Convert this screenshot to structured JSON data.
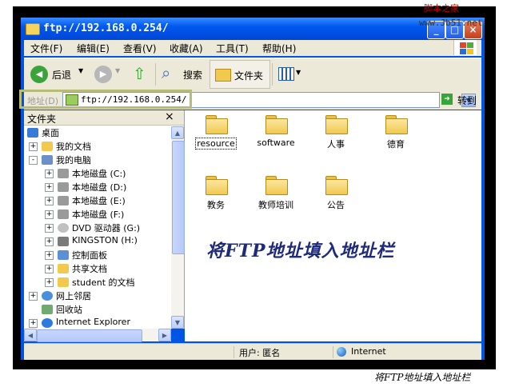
{
  "window": {
    "title": "ftp://192.168.0.254/",
    "watermark": "脚本之家",
    "watermark_url": "www.Jb51.net"
  },
  "menu": [
    "文件(F)",
    "编辑(E)",
    "查看(V)",
    "收藏(A)",
    "工具(T)",
    "帮助(H)"
  ],
  "toolbar": {
    "back_label": "后退",
    "search_label": "搜索",
    "folders_label": "文件夹"
  },
  "address": {
    "label": "地址(D)",
    "value": "ftp://192.168.0.254/",
    "go_label": "转到"
  },
  "folder_pane": {
    "title": "文件夹",
    "close": "×",
    "tree": [
      {
        "label": "桌面",
        "level": 0,
        "expander": "",
        "icon": "desktop-icon"
      },
      {
        "label": "我的文档",
        "level": 1,
        "expander": "+",
        "icon": "documents-icon"
      },
      {
        "label": "我的电脑",
        "level": 1,
        "expander": "-",
        "icon": "computer-icon"
      },
      {
        "label": "本地磁盘 (C:)",
        "level": 2,
        "expander": "+",
        "icon": "drive-icon"
      },
      {
        "label": "本地磁盘 (D:)",
        "level": 2,
        "expander": "+",
        "icon": "drive-icon"
      },
      {
        "label": "本地磁盘 (E:)",
        "level": 2,
        "expander": "+",
        "icon": "drive-icon"
      },
      {
        "label": "本地磁盘 (F:)",
        "level": 2,
        "expander": "+",
        "icon": "drive-icon"
      },
      {
        "label": "DVD 驱动器 (G:)",
        "level": 2,
        "expander": "+",
        "icon": "dvd-icon"
      },
      {
        "label": "KINGSTON (H:)",
        "level": 2,
        "expander": "+",
        "icon": "usb-drive-icon"
      },
      {
        "label": "控制面板",
        "level": 2,
        "expander": "+",
        "icon": "control-panel-icon"
      },
      {
        "label": "共享文档",
        "level": 2,
        "expander": "+",
        "icon": "folder-icon"
      },
      {
        "label": "student 的文档",
        "level": 2,
        "expander": "+",
        "icon": "folder-icon"
      },
      {
        "label": "网上邻居",
        "level": 1,
        "expander": "+",
        "icon": "network-icon"
      },
      {
        "label": "回收站",
        "level": 1,
        "expander": "",
        "icon": "recycle-bin-icon"
      },
      {
        "label": "Internet Explorer",
        "level": 1,
        "expander": "+",
        "icon": "ie-icon"
      }
    ]
  },
  "files": [
    {
      "name": "resource",
      "selected": true
    },
    {
      "name": "software",
      "selected": false
    },
    {
      "name": "人事",
      "selected": false
    },
    {
      "name": "德育",
      "selected": false
    },
    {
      "name": "教务",
      "selected": false
    },
    {
      "name": "教师培训",
      "selected": false
    },
    {
      "name": "公告",
      "selected": false
    }
  ],
  "annotation": "将FTP地址填入地址栏",
  "status": {
    "user": "用户: 匿名",
    "zone": "Internet"
  },
  "caption": "将FTP地址填入地址栏",
  "colors": {
    "titlebar": "#0058ee",
    "chrome": "#ece9d8",
    "highlight_border": "#b7bd77",
    "annotation": "#1e2a7a"
  }
}
